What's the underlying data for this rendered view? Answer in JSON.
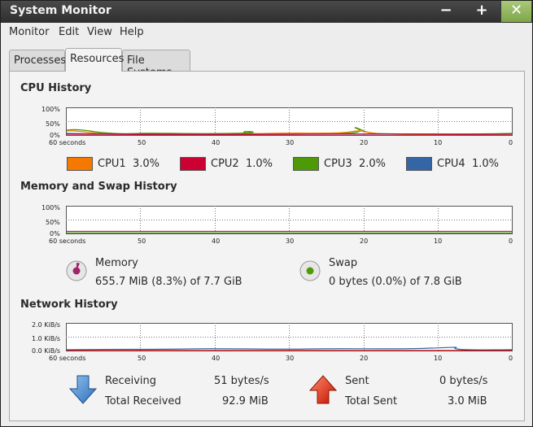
{
  "window": {
    "title": "System Monitor",
    "buttons": {
      "minimize": "−",
      "maximize": "+",
      "close": "✕"
    }
  },
  "menu": [
    "Monitor",
    "Edit",
    "View",
    "Help"
  ],
  "tabs": [
    {
      "label": "Processes",
      "active": false
    },
    {
      "label": "Resources",
      "active": true
    },
    {
      "label": "File Systems",
      "active": false
    }
  ],
  "cpu": {
    "title": "CPU History",
    "y_ticks": [
      "100%",
      "50%",
      "0%"
    ],
    "x_ticks": [
      "60 seconds",
      "50",
      "40",
      "30",
      "20",
      "10",
      "0"
    ],
    "legend": [
      {
        "name": "CPU1",
        "value": "3.0%",
        "color": "#f57900"
      },
      {
        "name": "CPU2",
        "value": "1.0%",
        "color": "#cc0033"
      },
      {
        "name": "CPU3",
        "value": "2.0%",
        "color": "#4e9a06"
      },
      {
        "name": "CPU4",
        "value": "1.0%",
        "color": "#3465a4"
      }
    ]
  },
  "memory": {
    "title": "Memory and Swap History",
    "y_ticks": [
      "100%",
      "50%",
      "0%"
    ],
    "x_ticks": [
      "60 seconds",
      "50",
      "40",
      "30",
      "20",
      "10",
      "0"
    ],
    "memory_label": "Memory",
    "memory_value": "655.7 MiB (8.3%) of 7.7 GiB",
    "memory_color": "#a3236a",
    "swap_label": "Swap",
    "swap_value": "0 bytes (0.0%) of 7.8 GiB",
    "swap_color": "#4e9a06"
  },
  "network": {
    "title": "Network History",
    "y_ticks": [
      "2.0 KiB/s",
      "1.0 KiB/s",
      "0.0 KiB/s"
    ],
    "x_ticks": [
      "60 seconds",
      "50",
      "40",
      "30",
      "20",
      "10",
      "0"
    ],
    "receiving_label": "Receiving",
    "receiving_value": "51 bytes/s",
    "total_received_label": "Total Received",
    "total_received_value": "92.9 MiB",
    "sent_label": "Sent",
    "sent_value": "0 bytes/s",
    "total_sent_label": "Total Sent",
    "total_sent_value": "3.0 MiB",
    "receiving_color": "#3465a4",
    "sent_color": "#cc0000"
  }
}
